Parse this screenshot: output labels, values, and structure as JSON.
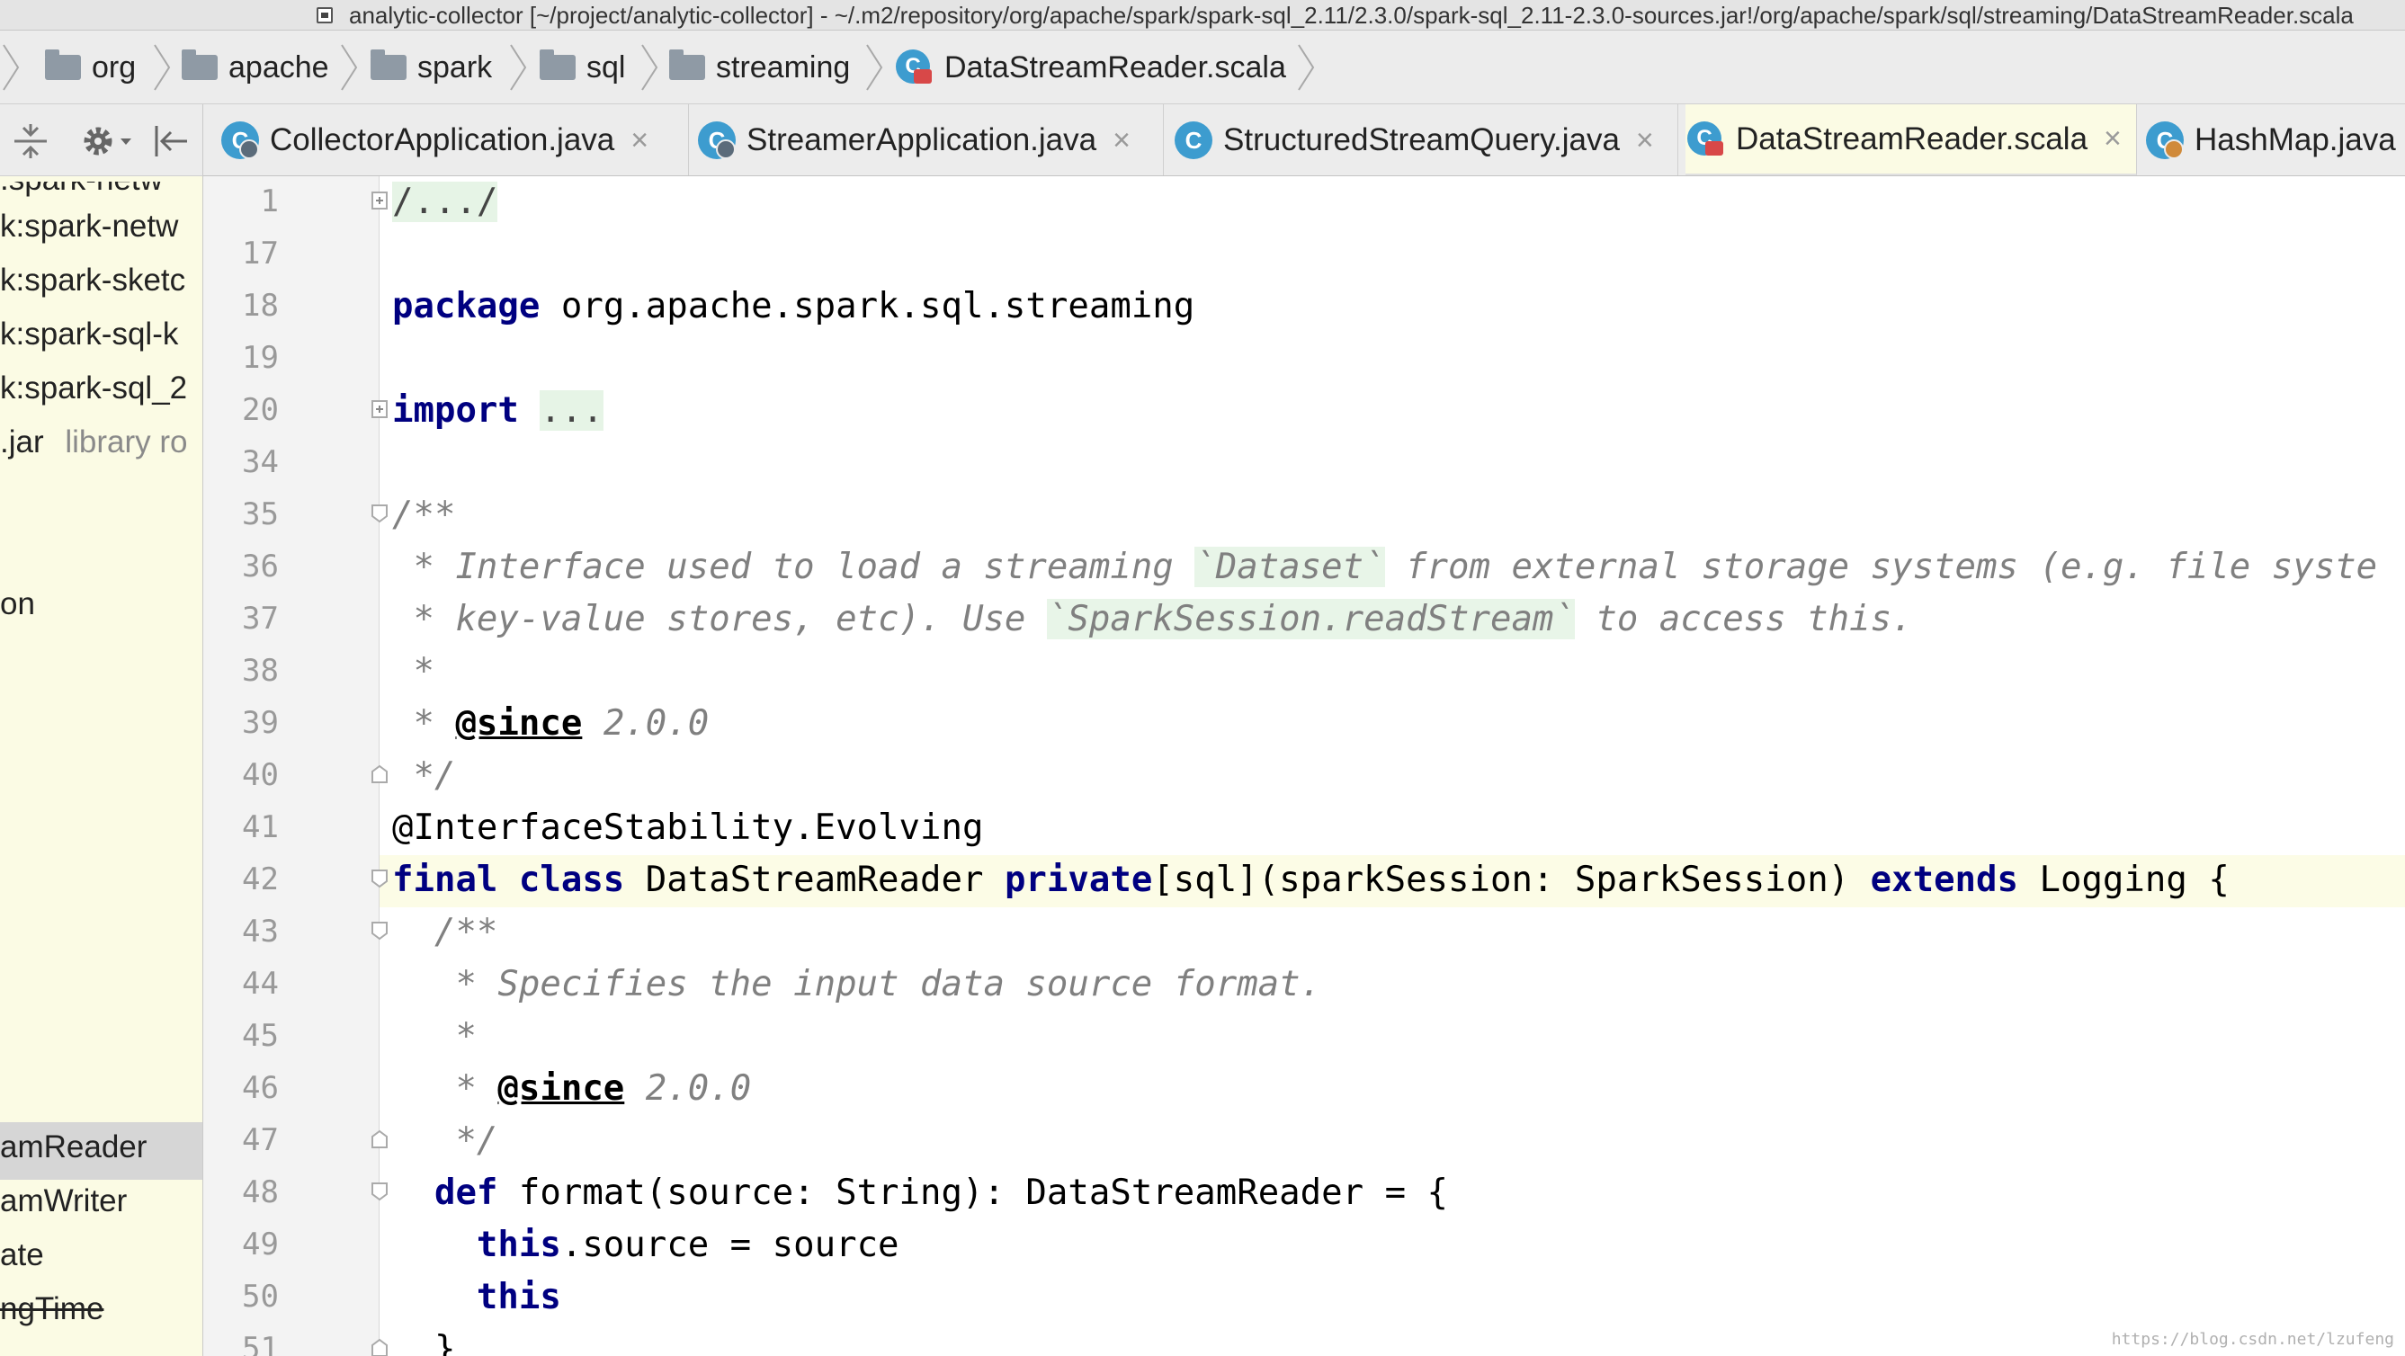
{
  "window": {
    "title": "analytic-collector [~/project/analytic-collector] - ~/.m2/repository/org/apache/spark/spark-sql_2.11/2.3.0/spark-sql_2.11-2.3.0-sources.jar!/org/apache/spark/sql/streaming/DataStreamReader.scala"
  },
  "breadcrumb": {
    "items": [
      "org",
      "apache",
      "spark",
      "sql",
      "streaming"
    ],
    "file": "DataStreamReader.scala"
  },
  "tabs": [
    {
      "label": "CollectorApplication.java",
      "close": "×",
      "icon": "java-app-class-icon"
    },
    {
      "label": "StreamerApplication.java",
      "close": "×",
      "icon": "java-app-class-icon"
    },
    {
      "label": "StructuredStreamQuery.java",
      "close": "×",
      "icon": "java-class-icon"
    },
    {
      "label": "DataStreamReader.scala",
      "close": "×",
      "icon": "scala-class-icon",
      "active": true
    },
    {
      "label": "HashMap.java",
      "close": "",
      "icon": "java-class-icon"
    }
  ],
  "project_panel": {
    "items": [
      ":spark-netw",
      "k:spark-netw",
      "k:spark-sketc",
      "k:spark-sql-k",
      "k:spark-sql_2",
      ".jar",
      "on",
      "amReader",
      "amWriter",
      "ate",
      "ngTime"
    ],
    "library_hint": "library ro",
    "selected": "amReader"
  },
  "editor": {
    "lines": [
      {
        "n": "1"
      },
      {
        "n": "17"
      },
      {
        "n": "18"
      },
      {
        "n": "19"
      },
      {
        "n": "20"
      },
      {
        "n": "34"
      },
      {
        "n": "35"
      },
      {
        "n": "36"
      },
      {
        "n": "37"
      },
      {
        "n": "38"
      },
      {
        "n": "39"
      },
      {
        "n": "40"
      },
      {
        "n": "41"
      },
      {
        "n": "42"
      },
      {
        "n": "43"
      },
      {
        "n": "44"
      },
      {
        "n": "45"
      },
      {
        "n": "46"
      },
      {
        "n": "47"
      },
      {
        "n": "48"
      },
      {
        "n": "49"
      },
      {
        "n": "50"
      },
      {
        "n": "51"
      }
    ],
    "folded_header": "/.../",
    "kw_package": "package",
    "package_name": " org.apache.spark.sql.streaming",
    "kw_import": "import",
    "folded_import": "...",
    "doc_open": "/**",
    "doc36_a": " * Interface used to load a streaming ",
    "doc36_b": "`Dataset`",
    "doc36_c": " from external storage systems (e.g. file syste",
    "doc37_a": " * key-value stores, etc). Use ",
    "doc37_b": "`SparkSession.readStream`",
    "doc37_c": " to access this.",
    "doc38": " *",
    "doc39_a": " * ",
    "since_tag": "@since",
    "version": " 2.0.0",
    "doc_close": " */",
    "annotation": "@InterfaceStability.Evolving",
    "l42_final": "final",
    "l42_class": "class",
    "l42_name": " DataStreamReader ",
    "l42_private": "private",
    "l42_rest": "[sql](sparkSession: SparkSession) ",
    "l42_extends": "extends",
    "l42_end": " Logging {",
    "doc43": "  /**",
    "doc44": "   * Specifies the input data source format.",
    "doc45": "   *",
    "doc46_a": "   * ",
    "doc47": "   */",
    "kw_def": "def",
    "l48_rest": " format(source: String): DataStreamReader = {",
    "l49_indent": "    ",
    "kw_this": "this",
    "l49_rest": ".source = source",
    "l51": "  }"
  },
  "watermark": "https://blog.csdn.net/lzufeng"
}
